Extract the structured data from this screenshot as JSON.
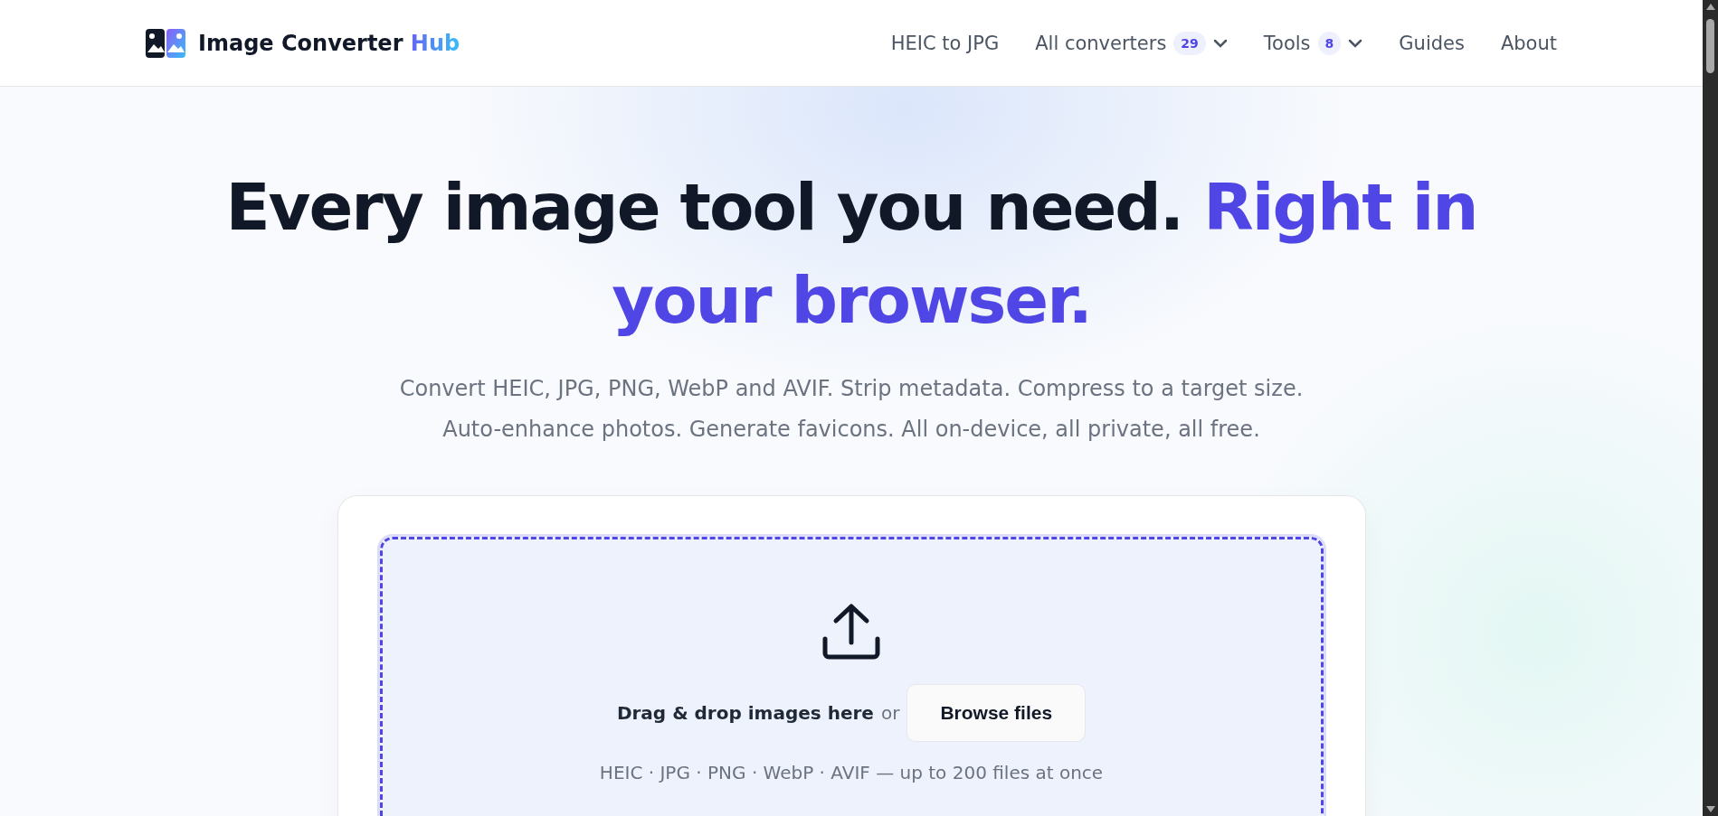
{
  "brand": {
    "name": "Image Converter",
    "accent": "Hub"
  },
  "nav": [
    {
      "label": "HEIC to JPG",
      "dropdown": false
    },
    {
      "label": "All converters",
      "badge": "29",
      "dropdown": true
    },
    {
      "label": "Tools",
      "badge": "8",
      "dropdown": true
    },
    {
      "label": "Guides",
      "dropdown": false
    },
    {
      "label": "About",
      "dropdown": false
    }
  ],
  "hero": {
    "headline": "Every image tool you need.",
    "highlight": "Right in your browser.",
    "subtitle_lines": [
      "Convert HEIC, JPG, PNG, WebP and AVIF. Strip metadata. Compress to a target size.",
      "Auto-enhance photos. Generate favicons. All on-device, all private, all free."
    ]
  },
  "dropzone": {
    "prompt": "Drag & drop images here",
    "or": "or",
    "button": "Browse files",
    "formats": "HEIC · JPG · PNG · WebP · AVIF — up to 200 files at once"
  }
}
